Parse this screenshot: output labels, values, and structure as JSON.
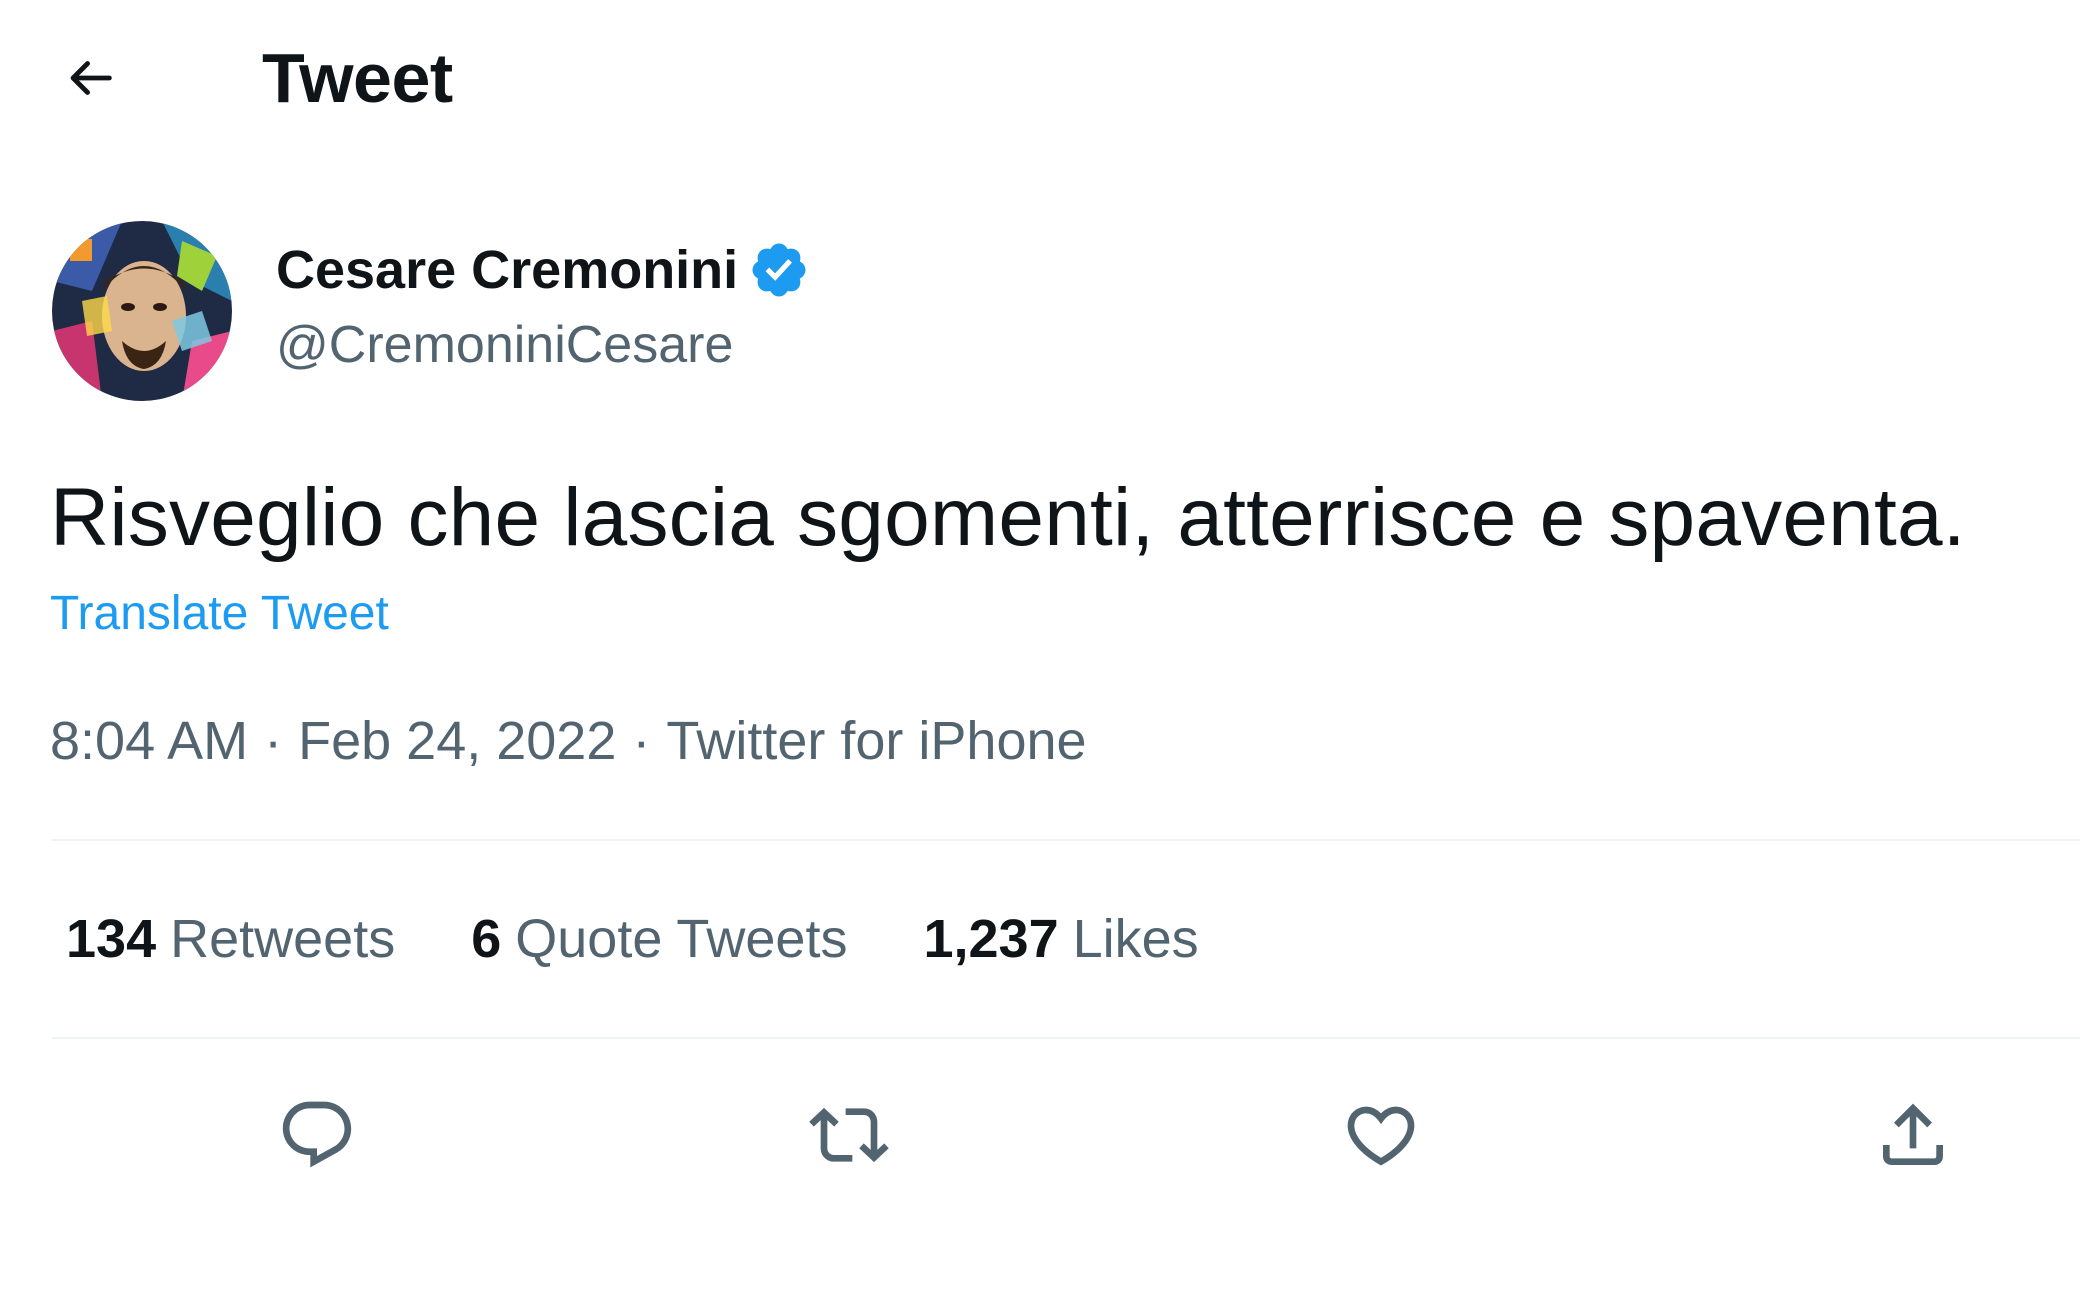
{
  "header": {
    "title": "Tweet",
    "back_icon": "arrow-left-icon"
  },
  "author": {
    "name": "Cesare Cremonini",
    "handle": "@CremoniniCesare",
    "verified": true,
    "verified_color": "#1d9bf0"
  },
  "tweet": {
    "text": "Risveglio che lascia sgomenti, atterrisce e spaventa.",
    "translate_label": "Translate Tweet"
  },
  "meta": {
    "time": "8:04 AM",
    "separator": "·",
    "date": "Feb 24, 2022",
    "source": "Twitter for iPhone"
  },
  "stats": {
    "retweets": {
      "count": "134",
      "label": "Retweets"
    },
    "quotes": {
      "count": "6",
      "label": "Quote Tweets"
    },
    "likes": {
      "count": "1,237",
      "label": "Likes"
    }
  },
  "actions": [
    {
      "name": "reply",
      "icon": "reply-icon"
    },
    {
      "name": "retweet",
      "icon": "retweet-icon"
    },
    {
      "name": "like",
      "icon": "heart-icon"
    },
    {
      "name": "share",
      "icon": "share-icon"
    }
  ],
  "colors": {
    "text_primary": "#0f1419",
    "text_secondary": "#536471",
    "accent": "#1d9bf0",
    "divider": "#eff3f4"
  }
}
